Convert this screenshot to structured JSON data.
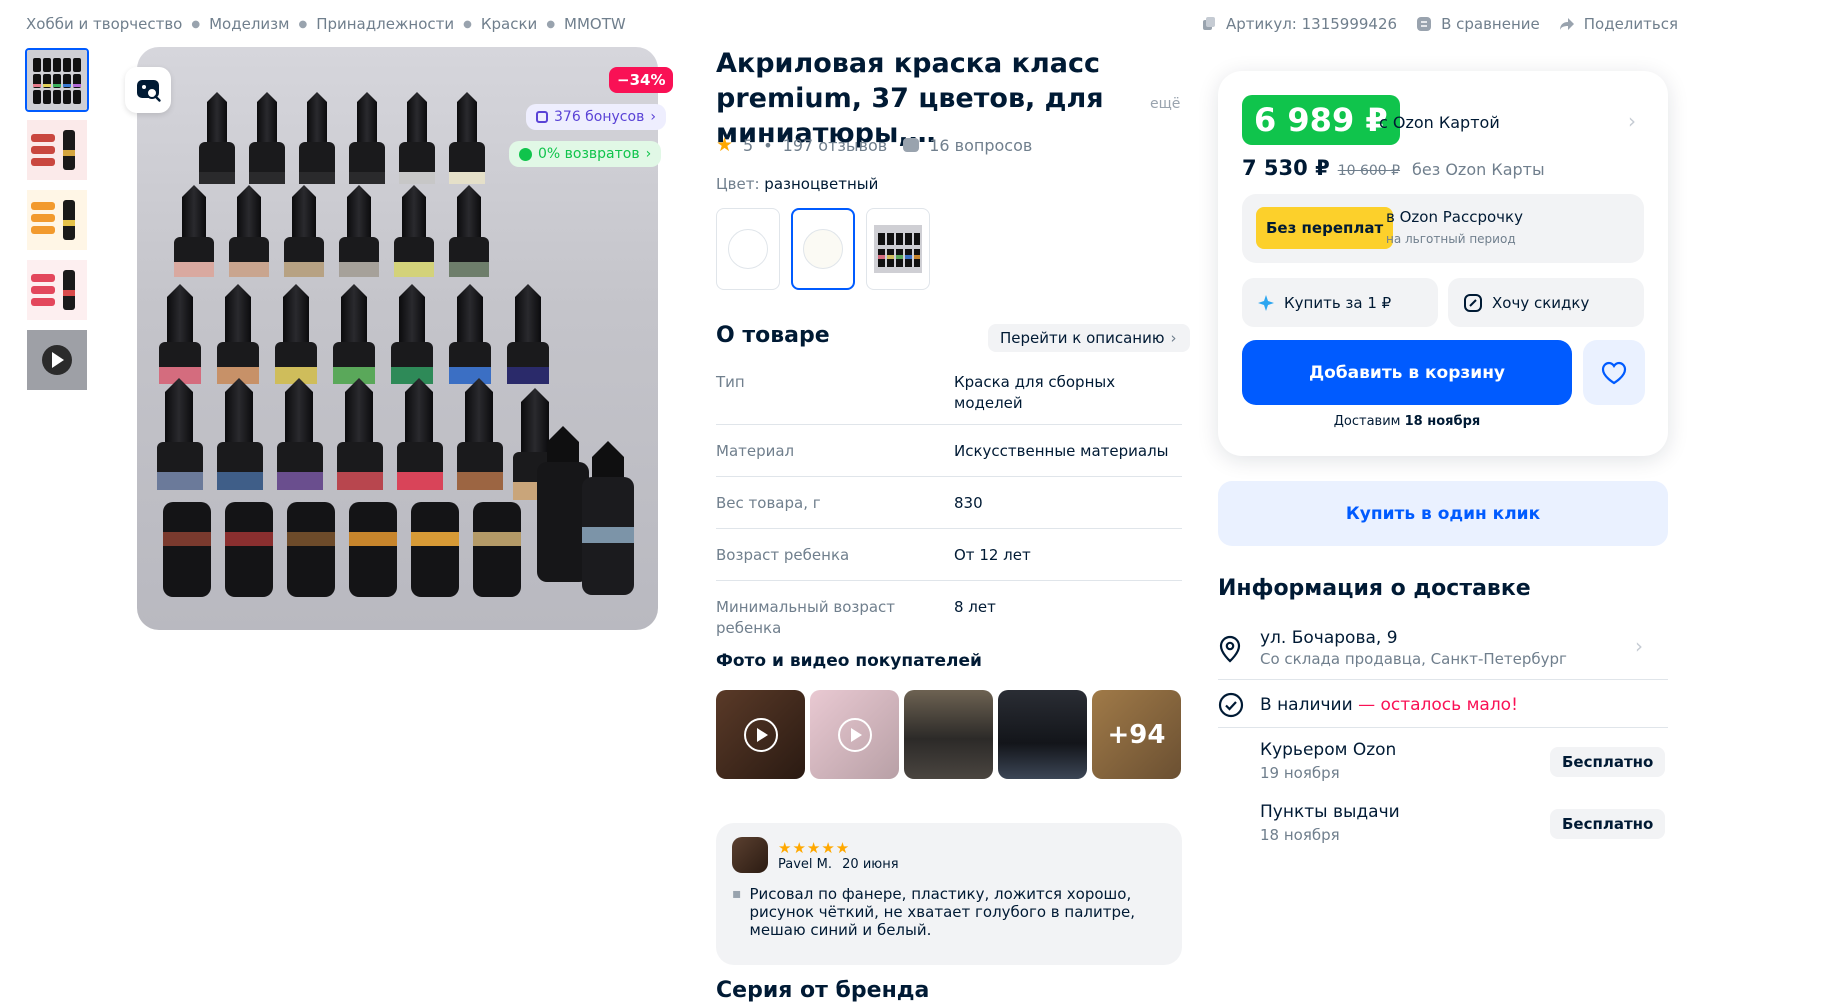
{
  "breadcrumbs": [
    "Хобби и творчество",
    "Моделизм",
    "Принадлежности",
    "Краски",
    "MMOTW"
  ],
  "top_actions": {
    "article": "Артикул: 1315999426",
    "compare": "В сравнение",
    "share": "Поделиться"
  },
  "gallery": {
    "thumbnails": [
      "photo-paints",
      "infographic-1",
      "infographic-2",
      "infographic-3",
      "video"
    ],
    "discount": "−34%",
    "bonus": "376 бонусов",
    "returns": "0% возвратов"
  },
  "product": {
    "title": "Акриловая краска класс premium, 37 цветов, для миниатюры,…",
    "more": "ещё",
    "rating": "5",
    "reviews": "197 отзывов",
    "questions": "16 вопросов",
    "color_label": "Цвет:",
    "color_value": "разноцветный"
  },
  "about": {
    "title": "О товаре",
    "goto_description": "Перейти к описанию",
    "specs": [
      {
        "key": "Тип",
        "value": "Краска для сборных моделей"
      },
      {
        "key": "Материал",
        "value": "Искусственные материалы"
      },
      {
        "key": "Вес товара, г",
        "value": "830"
      },
      {
        "key": "Возраст ребенка",
        "value": "От 12 лет"
      },
      {
        "key": "Минимальный возраст ребенка",
        "value": "8 лет"
      }
    ]
  },
  "ugc": {
    "title": "Фото и видео покупателей",
    "more_count": "+94"
  },
  "review": {
    "author": "Pavel M.",
    "date": "20 июня",
    "stars": "★★★★★",
    "text": "Рисовал по фанере, пластику, ложится хорошо, рисунок чёткий, не хватает голубого в палитре, мешаю синий и белый."
  },
  "series_title": "Серия от бренда",
  "price": {
    "ozon_card_price": "6 989 ₽",
    "with_card": "с Ozon Картой",
    "regular_price": "7 530 ₽",
    "old_price": "10 600 ₽",
    "without_card": "без Ozon Карты",
    "no_overpay": "Без переплат",
    "installment_title": "в Ozon Рассрочку",
    "installment_sub": "на льготный период",
    "buy_for_1": "Купить за 1 ₽",
    "want_discount": "Хочу скидку",
    "add_to_cart": "Добавить в корзину",
    "deliver_prefix": "Доставим",
    "deliver_date": "18 ноября",
    "one_click": "Купить в один клик"
  },
  "delivery": {
    "title": "Информация о доставке",
    "street": "ул. Бочарова, 9",
    "from": "Со склада продавца, Санкт-Петербург",
    "in_stock": "В наличии",
    "low_stock": "— осталось мало!",
    "options": [
      {
        "name": "Курьером Ozon",
        "date": "19 ноября",
        "price": "Бесплатно"
      },
      {
        "name": "Пункты выдачи",
        "date": "18 ноября",
        "price": "Бесплатно"
      }
    ]
  },
  "colors": {
    "accent": "#005bff",
    "green": "#10c44c",
    "sale": "#f91155",
    "yellow": "#fcd02b",
    "text": "#001a34",
    "muted": "#707f8d"
  }
}
